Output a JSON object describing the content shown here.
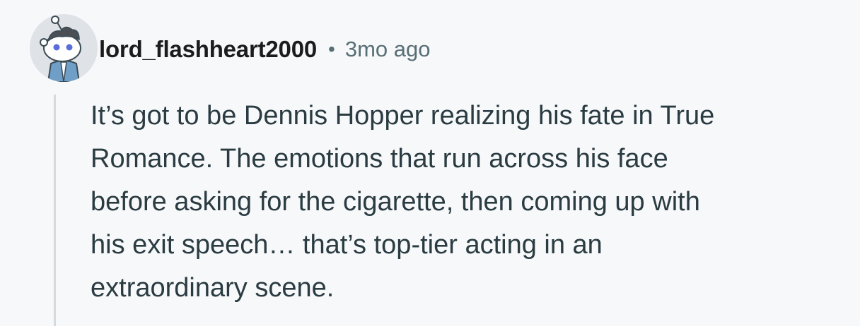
{
  "comment": {
    "author": "lord_flashheart2000",
    "separator": "•",
    "timestamp": "3mo ago",
    "avatar_icon": "snoo-avatar-icon",
    "body_lines": [
      "It’s got to be Dennis Hopper realizing his fate in True",
      "Romance. The emotions that run across his face",
      "before asking for the cigarette, then coming up with",
      "his exit speech… that’s top-tier acting in an",
      "extraordinary scene."
    ]
  },
  "colors": {
    "background": "#f7f8fa",
    "author_text": "#1c1c1c",
    "meta_text": "#576f76",
    "body_text": "#2a3c42",
    "thread_line": "#d5dade"
  }
}
